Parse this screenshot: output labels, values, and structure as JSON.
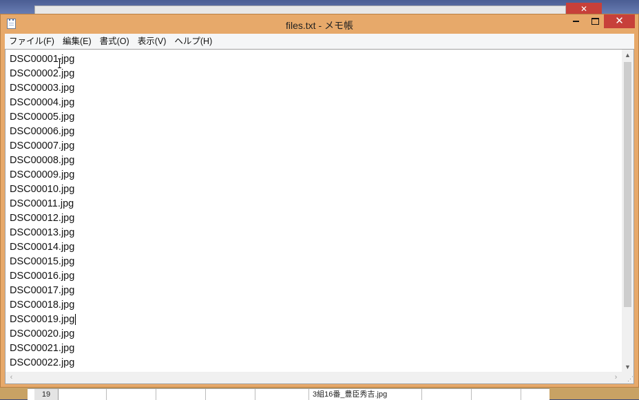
{
  "window": {
    "title": "files.txt - メモ帳",
    "close_glyph": "✕"
  },
  "background": {
    "close_glyph": "✕",
    "sheet_row": "19",
    "sheet_cell": "3組16番_豊臣秀吉.jpg"
  },
  "menu": [
    {
      "label": "ファイル(F)"
    },
    {
      "label": "編集(E)"
    },
    {
      "label": "書式(O)"
    },
    {
      "label": "表示(V)"
    },
    {
      "label": "ヘルプ(H)"
    }
  ],
  "editor": {
    "lines": [
      "DSC00001.jpg",
      "DSC00002.jpg",
      "DSC00003.jpg",
      "DSC00004.jpg",
      "DSC00005.jpg",
      "DSC00006.jpg",
      "DSC00007.jpg",
      "DSC00008.jpg",
      "DSC00009.jpg",
      "DSC00010.jpg",
      "DSC00011.jpg",
      "DSC00012.jpg",
      "DSC00013.jpg",
      "DSC00014.jpg",
      "DSC00015.jpg",
      "DSC00016.jpg",
      "DSC00017.jpg",
      "DSC00018.jpg",
      "DSC00019.jpg",
      "DSC00020.jpg",
      "DSC00021.jpg",
      "DSC00022.jpg"
    ],
    "caret_line": 18
  },
  "scrollbars": {
    "up": "▲",
    "down": "▼",
    "left": "‹",
    "right": "›",
    "grip": "⋰"
  },
  "colors": {
    "frame": "#e7a96a",
    "close_button": "#c7403a"
  },
  "icons": {
    "app": "notepad-icon",
    "minimize": "minimize-icon",
    "maximize": "maximize-icon",
    "close": "close-icon"
  }
}
